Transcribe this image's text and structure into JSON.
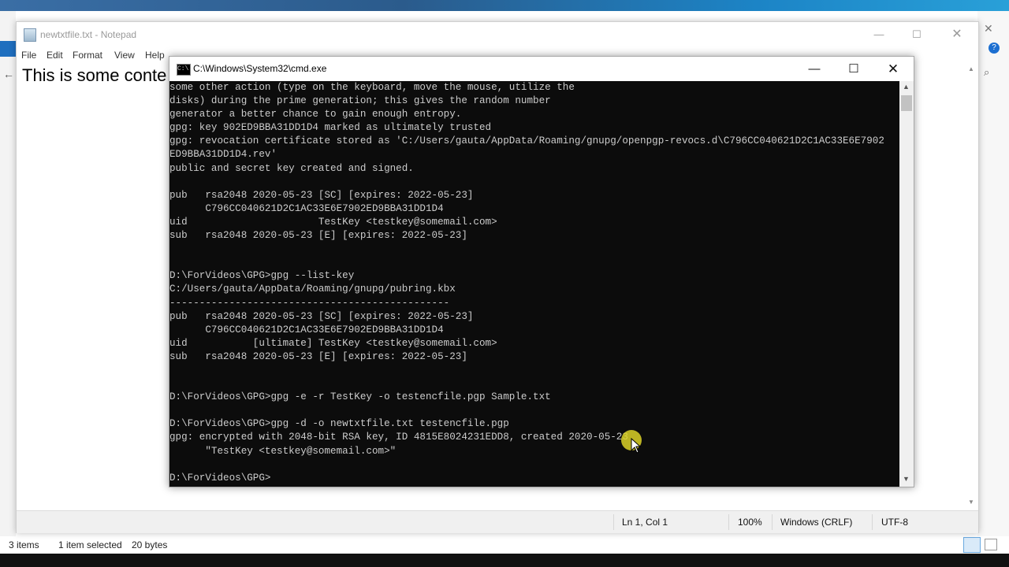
{
  "notepad": {
    "title": "newtxtfile.txt - Notepad",
    "menu": [
      "File",
      "Edit",
      "Format",
      "View",
      "Help"
    ],
    "content": "This is some conte",
    "status": {
      "position": "Ln 1, Col 1",
      "zoom": "100%",
      "line_ending": "Windows (CRLF)",
      "encoding": "UTF-8"
    }
  },
  "cmd": {
    "title": "C:\\Windows\\System32\\cmd.exe",
    "lines": [
      "some other action (type on the keyboard, move the mouse, utilize the",
      "disks) during the prime generation; this gives the random number",
      "generator a better chance to gain enough entropy.",
      "gpg: key 902ED9BBA31DD1D4 marked as ultimately trusted",
      "gpg: revocation certificate stored as 'C:/Users/gauta/AppData/Roaming/gnupg/openpgp-revocs.d\\C796CC040621D2C1AC33E6E7902",
      "ED9BBA31DD1D4.rev'",
      "public and secret key created and signed.",
      "",
      "pub   rsa2048 2020-05-23 [SC] [expires: 2022-05-23]",
      "      C796CC040621D2C1AC33E6E7902ED9BBA31DD1D4",
      "uid                      TestKey <testkey@somemail.com>",
      "sub   rsa2048 2020-05-23 [E] [expires: 2022-05-23]",
      "",
      "",
      "D:\\ForVideos\\GPG>gpg --list-key",
      "C:/Users/gauta/AppData/Roaming/gnupg/pubring.kbx",
      "-----------------------------------------------",
      "pub   rsa2048 2020-05-23 [SC] [expires: 2022-05-23]",
      "      C796CC040621D2C1AC33E6E7902ED9BBA31DD1D4",
      "uid           [ultimate] TestKey <testkey@somemail.com>",
      "sub   rsa2048 2020-05-23 [E] [expires: 2022-05-23]",
      "",
      "",
      "D:\\ForVideos\\GPG>gpg -e -r TestKey -o testencfile.pgp Sample.txt",
      "",
      "D:\\ForVideos\\GPG>gpg -d -o newtxtfile.txt testencfile.pgp",
      "gpg: encrypted with 2048-bit RSA key, ID 4815E8024231EDD8, created 2020-05-23",
      "      \"TestKey <testkey@somemail.com>\"",
      "",
      "D:\\ForVideos\\GPG>"
    ]
  },
  "explorer": {
    "status_items": "3 items",
    "status_selected": "1 item selected",
    "status_size": "20 bytes"
  },
  "colors": {
    "cmd_bg": "#0c0c0c",
    "cmd_text": "#cccccc",
    "cursor_highlight": "#dcd228"
  }
}
